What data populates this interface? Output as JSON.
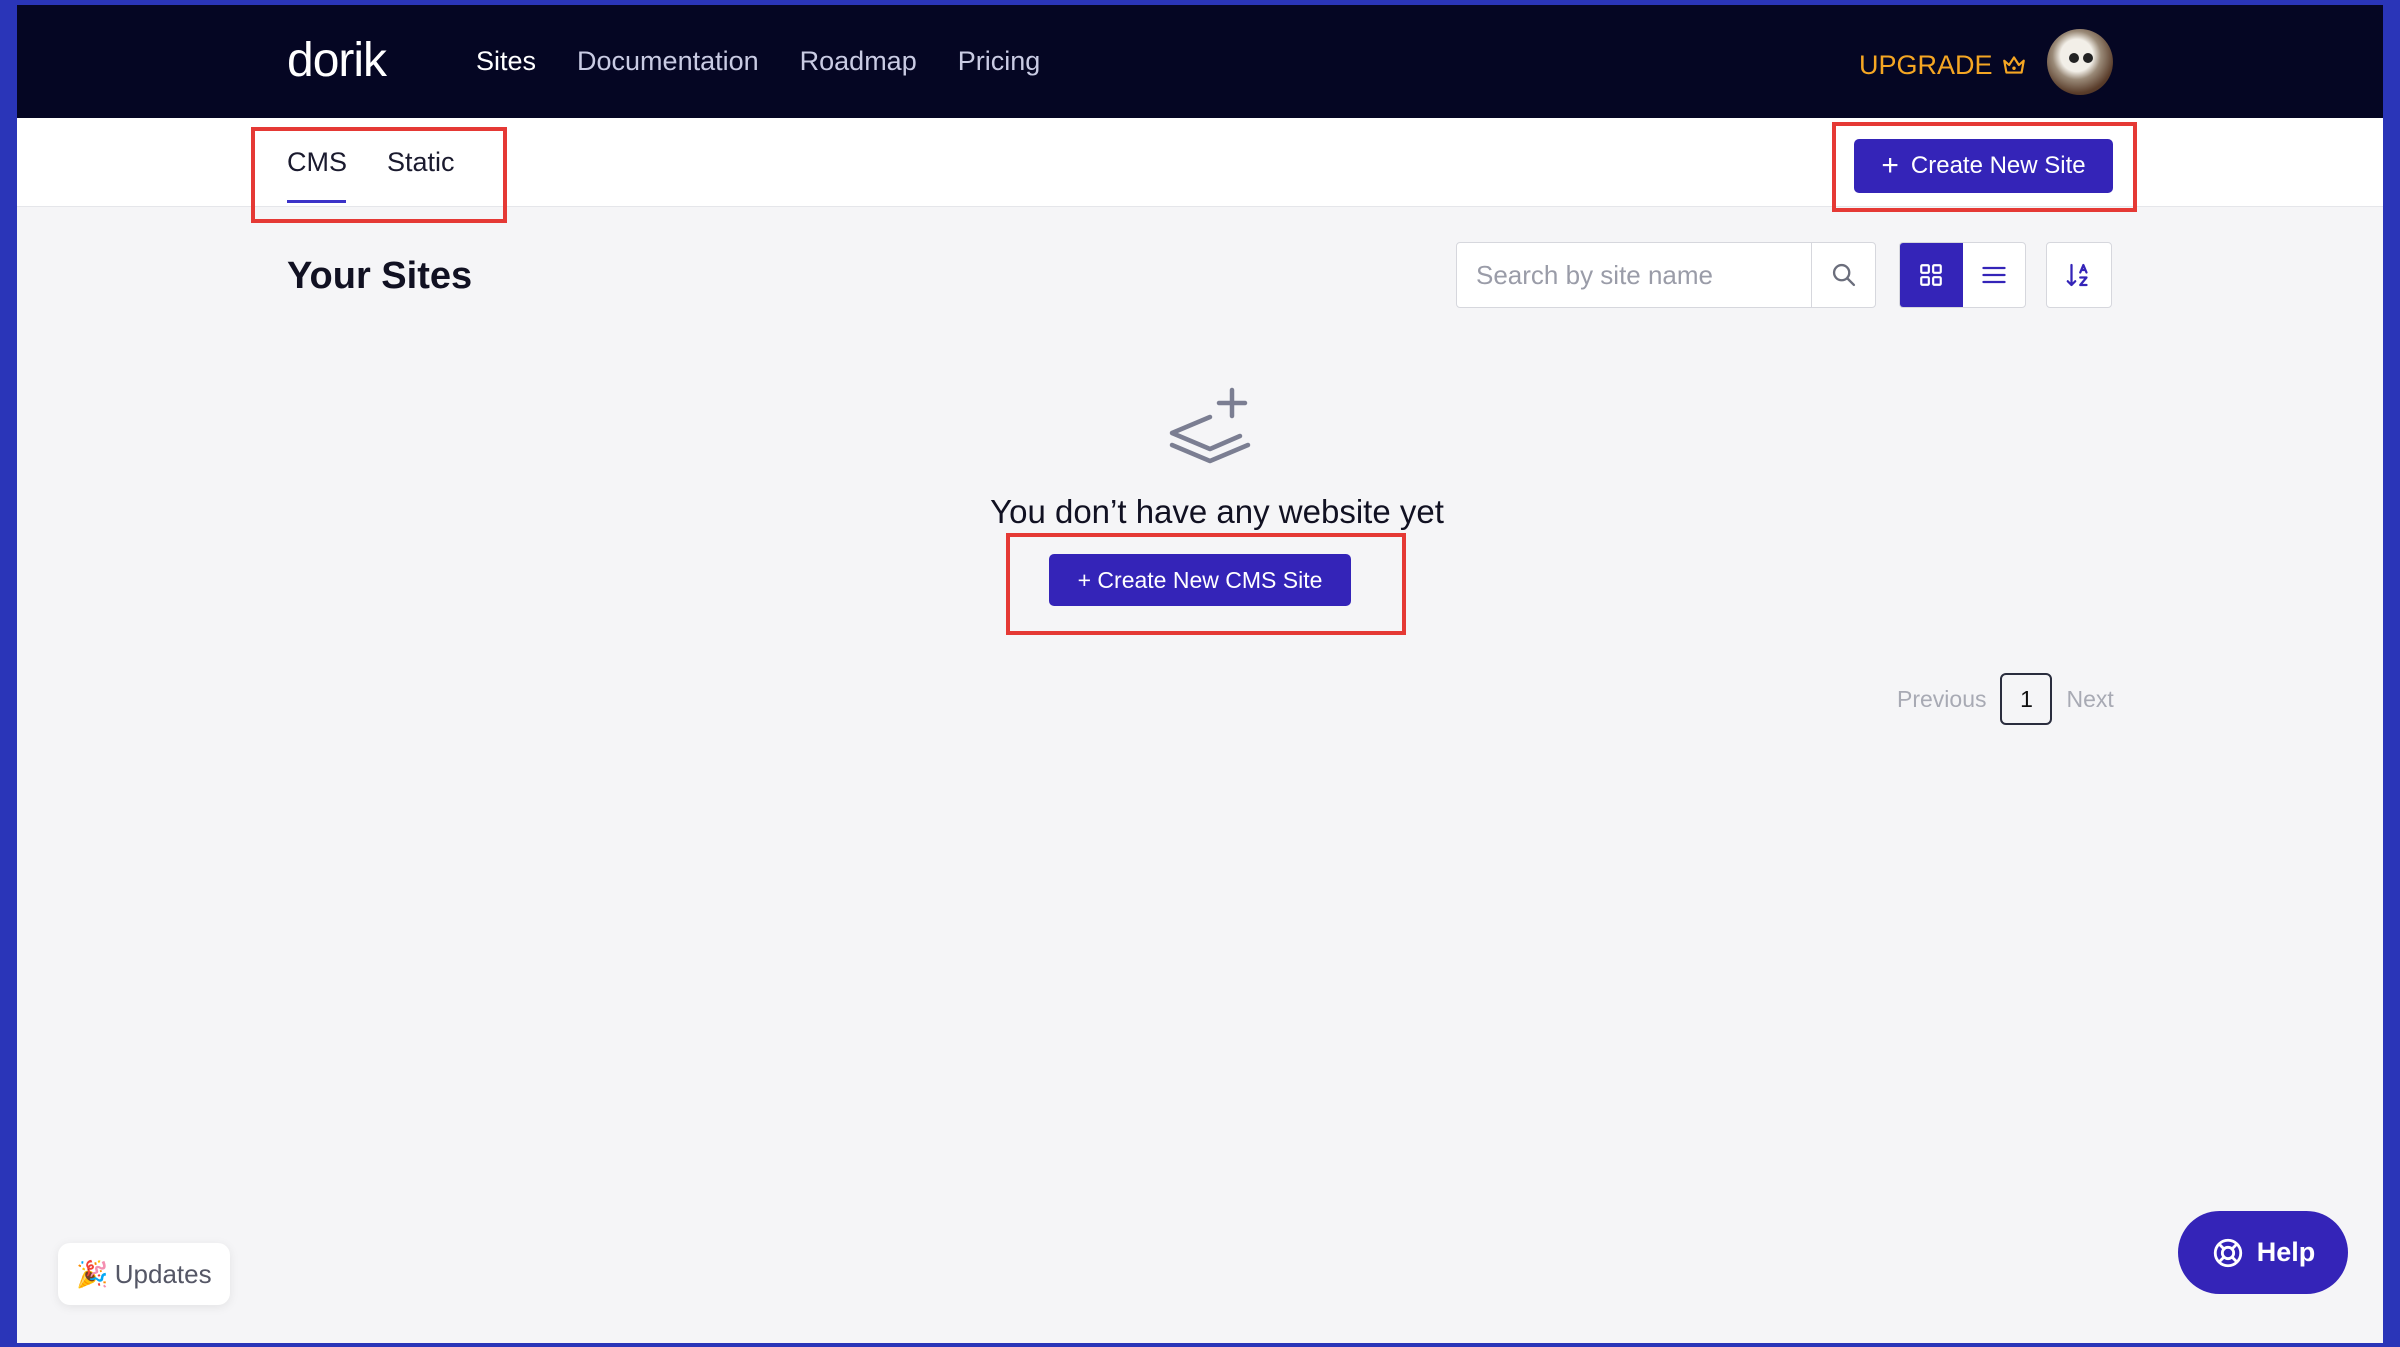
{
  "header": {
    "logo": "dorik",
    "nav": [
      {
        "label": "Sites",
        "active": true
      },
      {
        "label": "Documentation",
        "active": false
      },
      {
        "label": "Roadmap",
        "active": false
      },
      {
        "label": "Pricing",
        "active": false
      }
    ],
    "upgrade_label": "UPGRADE",
    "upgrade_icon": "crown-icon",
    "upgrade_color": "#f5a623"
  },
  "subnav": {
    "tabs": [
      {
        "label": "CMS",
        "active": true
      },
      {
        "label": "Static",
        "active": false
      }
    ],
    "create_button_label": "Create New Site"
  },
  "main": {
    "title": "Your Sites",
    "search": {
      "placeholder": "Search by site name",
      "value": ""
    },
    "view_mode": "grid",
    "empty_state": {
      "icon": "layers-plus-icon",
      "message": "You don’t have any website yet",
      "button_label": "+ Create New CMS Site"
    },
    "pagination": {
      "previous": "Previous",
      "current_page": "1",
      "next": "Next"
    }
  },
  "footer": {
    "updates_label": "Updates",
    "updates_emoji": "🎉",
    "help_label": "Help"
  },
  "colors": {
    "primary": "#3424b8",
    "header_bg": "#050623",
    "annotation": "#e53935"
  }
}
